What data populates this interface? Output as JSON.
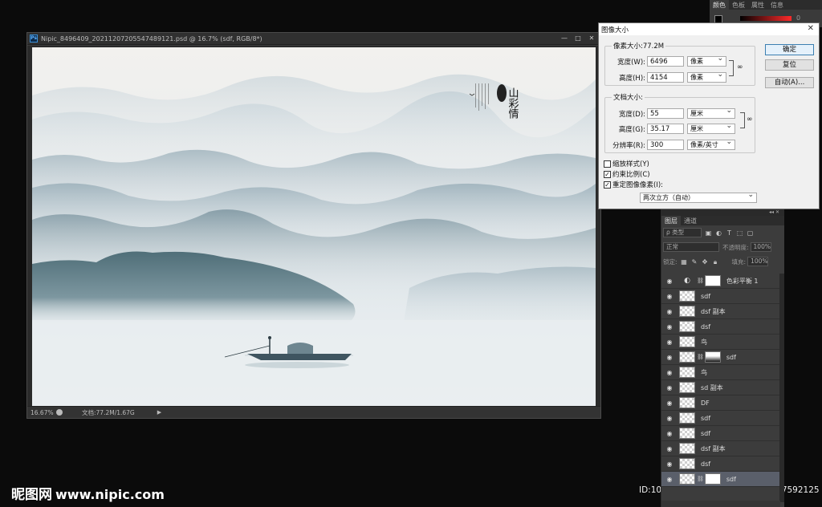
{
  "document": {
    "title": "Nipic_8496409_20211207205547489121.psd @ 16.7% (sdf, RGB/8*)",
    "app_icon": "Ps",
    "window_controls": [
      "—",
      "□",
      "✕"
    ],
    "status": {
      "zoom": "16.67%",
      "doc_info": "文档:77.2M/1.67G",
      "arrow": "▶"
    }
  },
  "painting": {
    "calligraphy": "山彩情",
    "seal": "印"
  },
  "watermark": {
    "brand": "昵图网",
    "url": "www.nipic.com",
    "id": "ID:10837967 NO:20211216125747592125"
  },
  "color_panel": {
    "tabs": [
      "颜色",
      "色板",
      "属性",
      "信息"
    ],
    "active_tab": "颜色",
    "channel_value": "0",
    "accent": "#ff2a2a"
  },
  "image_size_dialog": {
    "title": "图像大小",
    "close": "✕",
    "pixel_group": {
      "label": "像素大小:77.2M",
      "width_label": "宽度(W):",
      "width_value": "6496",
      "width_unit": "像素",
      "height_label": "高度(H):",
      "height_value": "4154",
      "height_unit": "像素"
    },
    "doc_group": {
      "label": "文档大小:",
      "width_label": "宽度(D):",
      "width_value": "55",
      "width_unit": "厘米",
      "height_label": "高度(G):",
      "height_value": "35.17",
      "height_unit": "厘米",
      "res_label": "分辨率(R):",
      "res_value": "300",
      "res_unit": "像素/英寸"
    },
    "checkboxes": [
      {
        "label": "缩放样式(Y)",
        "checked": false
      },
      {
        "label": "约束比例(C)",
        "checked": true
      },
      {
        "label": "重定图像像素(I):",
        "checked": true
      }
    ],
    "resample_method": "两次立方（自动）",
    "buttons": {
      "ok": "确定",
      "reset": "复位",
      "auto": "自动(A)..."
    }
  },
  "layers_panel": {
    "collapse": "◂◂ ✕",
    "tabs": [
      "图层",
      "通道"
    ],
    "active_tab": "图层",
    "filter_kind": "ρ 类型",
    "blend_mode": "正常",
    "opacity_label": "不透明度:",
    "opacity_value": "100%",
    "lock_label": "锁定:",
    "fill_label": "填充:",
    "fill_value": "100%",
    "layers": [
      {
        "name": "色彩平衡 1",
        "type": "adjustment",
        "mask": "white"
      },
      {
        "name": "sdf",
        "type": "raster"
      },
      {
        "name": "dsf 副本",
        "type": "raster"
      },
      {
        "name": "dsf",
        "type": "raster"
      },
      {
        "name": "鸟",
        "type": "raster"
      },
      {
        "name": "sdf",
        "type": "masked",
        "mask": "gradient"
      },
      {
        "name": "鸟",
        "type": "raster"
      },
      {
        "name": "sd 副本",
        "type": "raster"
      },
      {
        "name": "DF",
        "type": "raster"
      },
      {
        "name": "sdf",
        "type": "raster"
      },
      {
        "name": "sdf",
        "type": "raster"
      },
      {
        "name": "dsf 副本",
        "type": "raster"
      },
      {
        "name": "dsf",
        "type": "raster"
      },
      {
        "name": "sdf",
        "type": "masked",
        "mask": "white",
        "selected": true
      }
    ]
  }
}
